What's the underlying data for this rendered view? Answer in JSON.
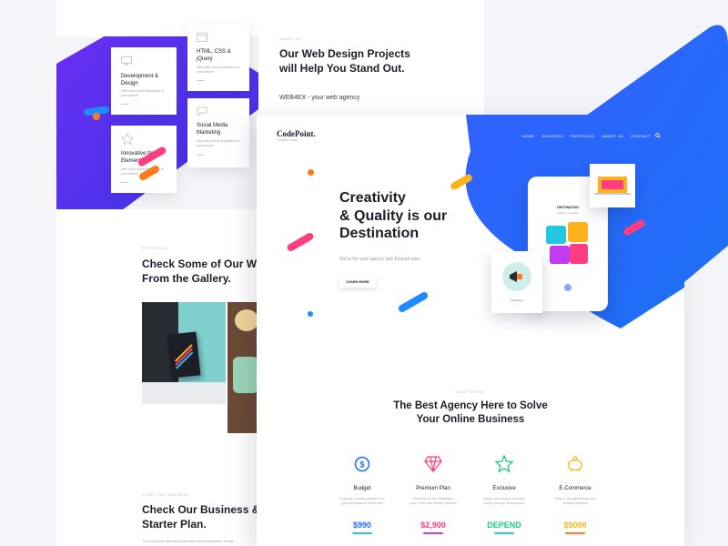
{
  "colors": {
    "brand_blue": "#1f6ff5",
    "purple": "#5b2df0",
    "pink": "#ff3d7f",
    "yellow": "#ffb31a",
    "orange": "#ff7a1a",
    "cyan": "#25c6e0",
    "green_price": "#1ec98a"
  },
  "back_page": {
    "services": [
      {
        "title": "Development & Design",
        "text": "Here will a short description of your service",
        "icon": "monitor-icon"
      },
      {
        "title": "HTML, CSS & jQuery",
        "text": "Here will a short description of your service",
        "icon": "code-window-icon"
      },
      {
        "title": "Social Media Marketing",
        "text": "Here will a short description of your service",
        "icon": "chat-bubble-icon"
      },
      {
        "title": "Innovative Item Elements",
        "text": "Here will a short description of your service",
        "icon": "star-outline-icon"
      }
    ],
    "about_eyebrow": "about us",
    "about_heading": "Our Web Design Projects will Help You Stand Out.",
    "about_sub": "WEB4EX - your web agency",
    "gallery_eyebrow": "portfolio",
    "gallery_heading": "Check Some of Our Work From the Gallery.",
    "pricing_eyebrow": "start the business",
    "pricing_heading": "Check Our Business & Starter Plan.",
    "pricing_text": "The corporate identity symbolizes professionalism & that"
  },
  "front_page": {
    "logo": "CodePoint.",
    "logo_tagline": "Creative studio",
    "nav": [
      "HOME",
      "SERVICES",
      "PORTFOLIO",
      "ABOUT US",
      "CONTACT"
    ],
    "hero_heading_line1": "Creativity",
    "hero_heading_line2": "& Quality is our",
    "hero_heading_line3": "Destination",
    "hero_sub": "We're the web agency with forward view",
    "hero_button": "LEARN MORE",
    "phone_label": "DESTINATION",
    "phone_sub": "Quality & Creativity",
    "card_caption": "Marketing",
    "section_eyebrow": "what we do",
    "section_heading_line1": "The Best Agency Here to Solve",
    "section_heading_line2": "Your Online Business",
    "services": [
      {
        "title": "Budget",
        "text": "A simple or cheap solution for a good appearance on the web",
        "price": "$990",
        "icon": "dollar-cycle-icon",
        "color": "#1f6ff5"
      },
      {
        "title": "Premium Plan",
        "text": "Compared to the competitors, more Corporate Identity solutions",
        "price": "$2,900",
        "icon": "diamond-icon",
        "color": "#ff3d7f"
      },
      {
        "title": "Exclusive",
        "text": "Unique web project, exclusive design and app development",
        "price": "DEPEND",
        "icon": "star-icon",
        "color": "#1ec98a"
      },
      {
        "title": "E-Commerce",
        "text": "Easy to use great design and working elements",
        "price": "$5000",
        "icon": "piggy-bank-icon",
        "color": "#ffb31a"
      }
    ]
  }
}
